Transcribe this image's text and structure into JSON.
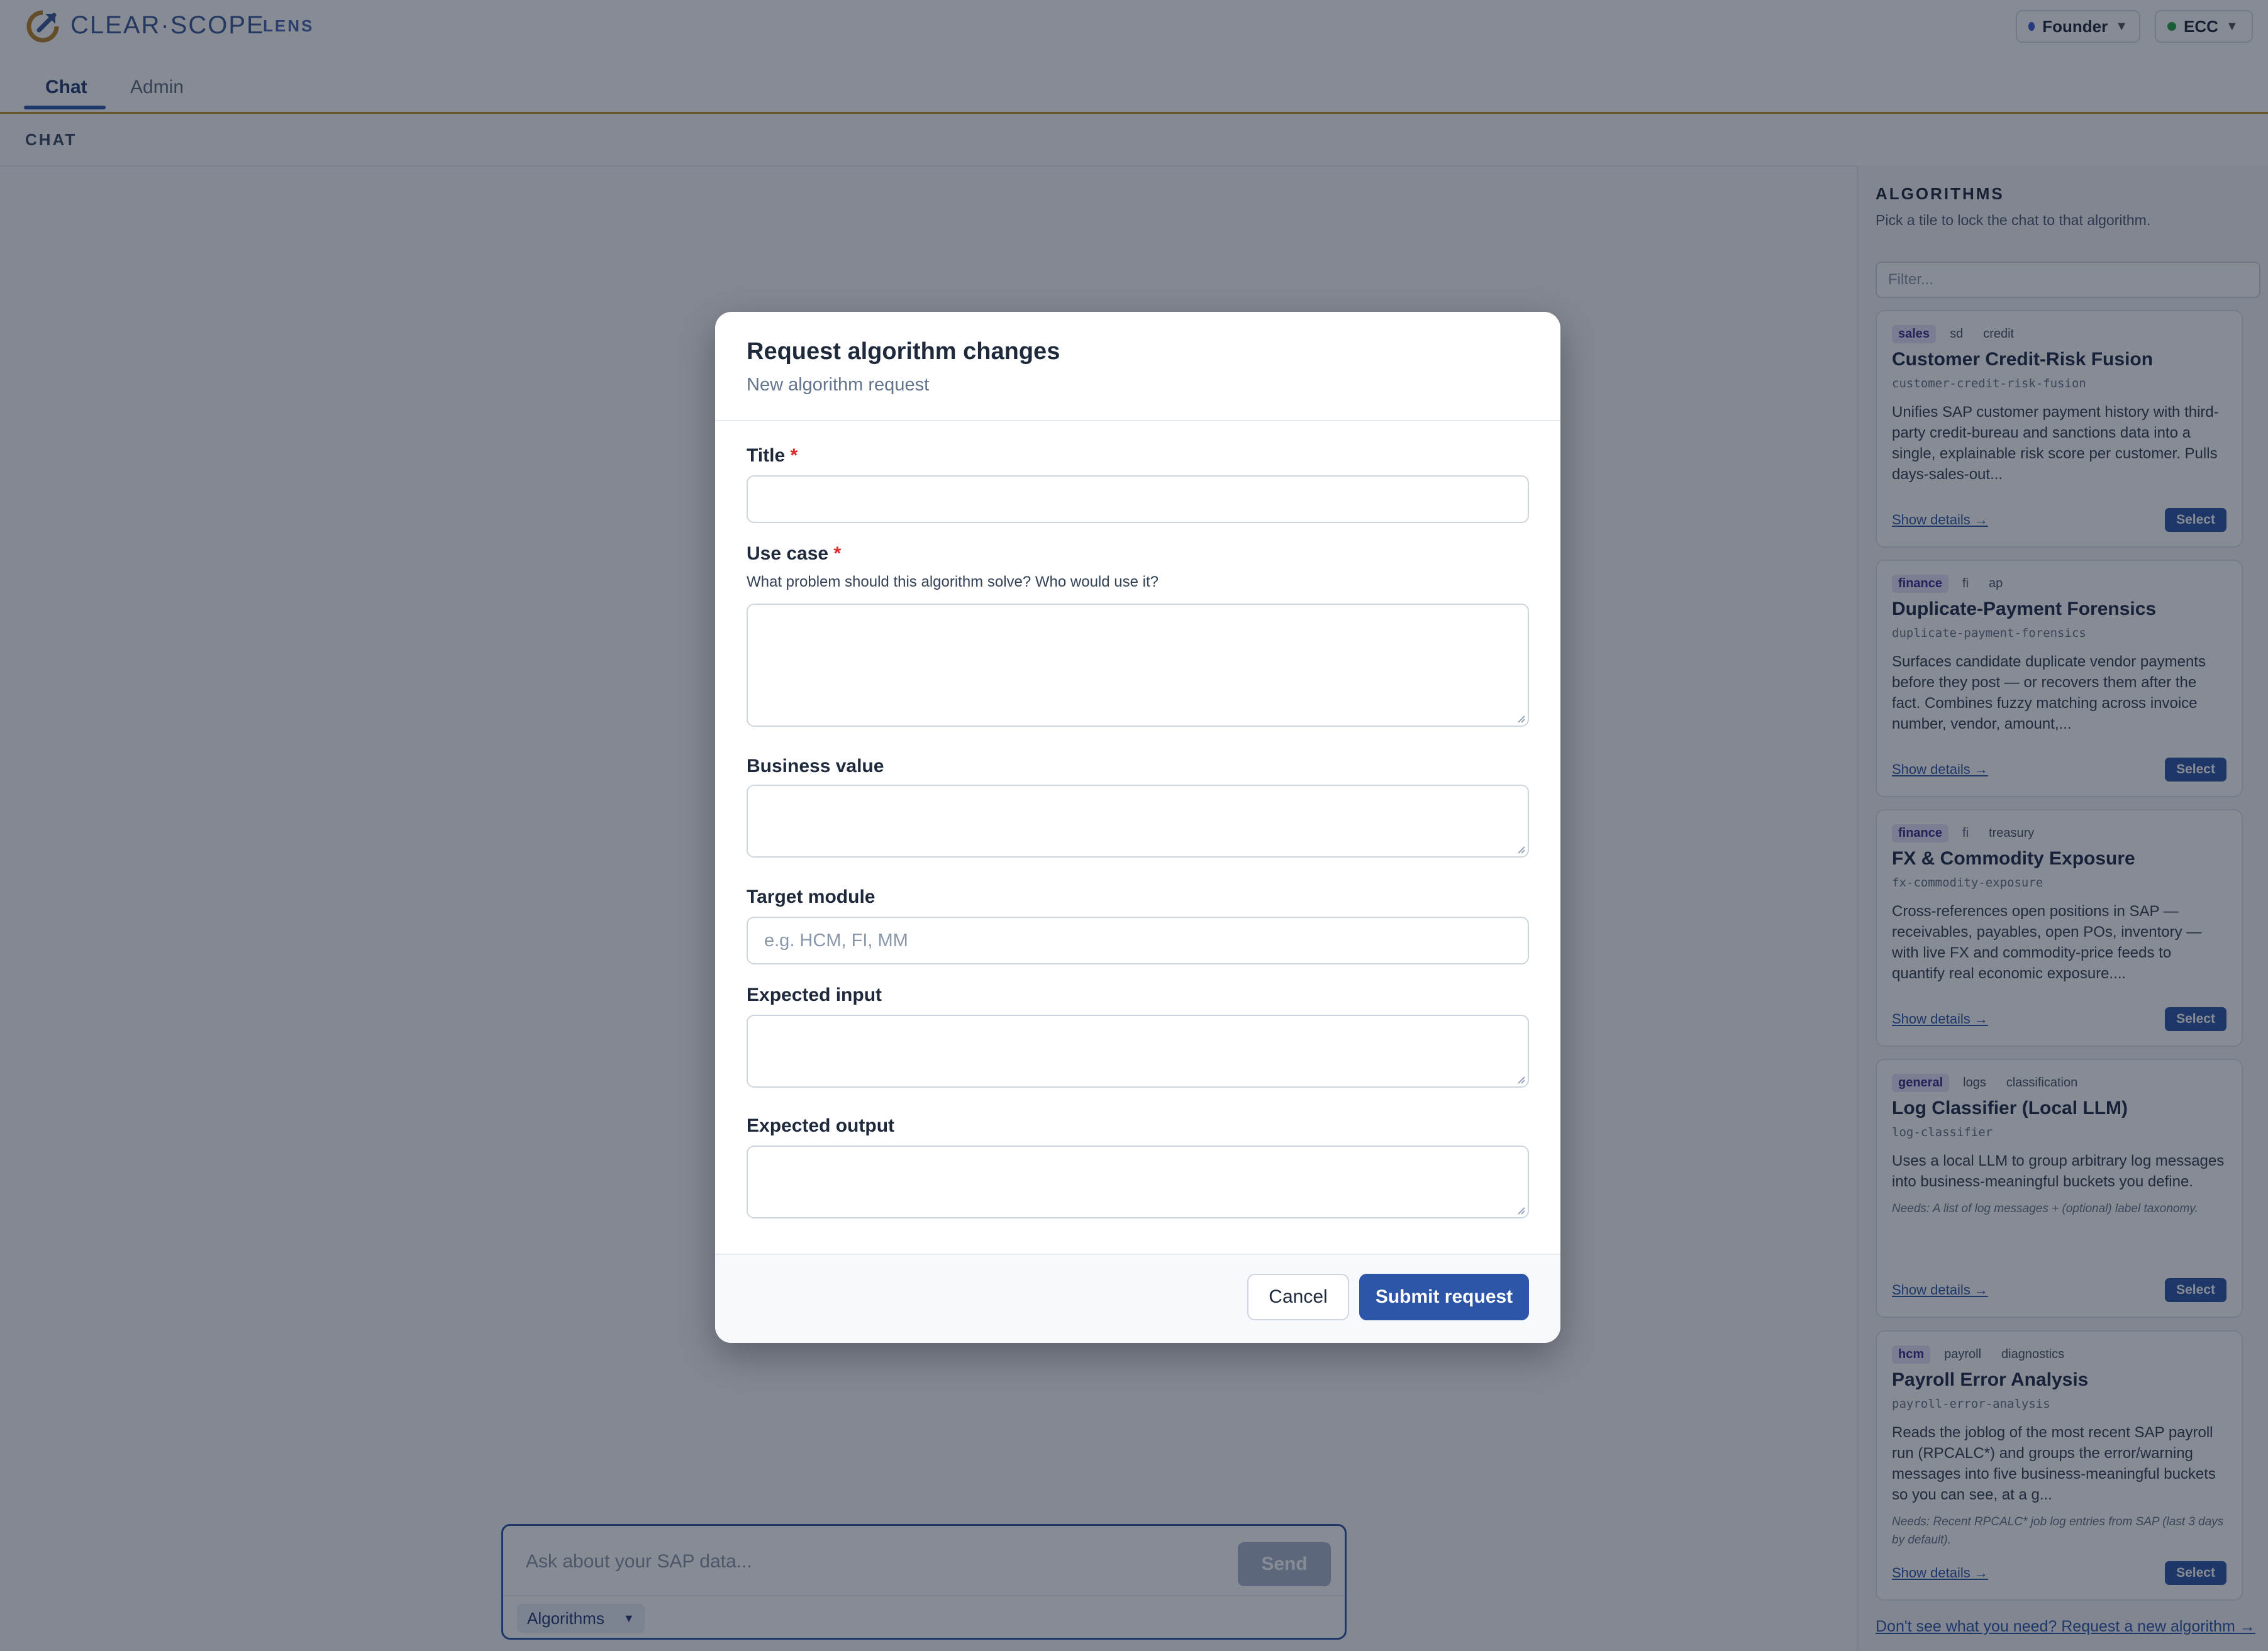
{
  "header": {
    "brand_name": "CLEAR·SCOPE",
    "brand_sub": "LENS",
    "user_role": "Founder",
    "system": "ECC",
    "colors": {
      "role_dot": "#3b5bdb",
      "system_dot": "#22a447"
    }
  },
  "tabs": [
    {
      "label": "Chat",
      "active": true
    },
    {
      "label": "Admin",
      "active": false
    }
  ],
  "section": {
    "label": "CHAT"
  },
  "composer": {
    "placeholder": "Ask about your SAP data...",
    "send_label": "Send",
    "algorithms_label": "Algorithms"
  },
  "sidebar": {
    "title": "ALGORITHMS",
    "subtitle": "Pick a tile to lock the chat to that algorithm.",
    "filter_placeholder": "Filter...",
    "footer_link": "Don't see what you need? Request a new algorithm →",
    "details_label": "Show details →",
    "select_label": "Select",
    "cards": [
      {
        "tags": [
          "sales",
          "sd",
          "credit"
        ],
        "title": "Customer Credit-Risk Fusion",
        "slug": "customer-credit-risk-fusion",
        "description": "Unifies SAP customer payment history with third-party credit-bureau and sanctions data into a single, explainable risk score per customer. Pulls days-sales-out...",
        "needs": ""
      },
      {
        "tags": [
          "finance",
          "fi",
          "ap"
        ],
        "title": "Duplicate-Payment Forensics",
        "slug": "duplicate-payment-forensics",
        "description": "Surfaces candidate duplicate vendor payments before they post — or recovers them after the fact. Combines fuzzy matching across invoice number, vendor, amount,...",
        "needs": ""
      },
      {
        "tags": [
          "finance",
          "fi",
          "treasury"
        ],
        "title": "FX & Commodity Exposure",
        "slug": "fx-commodity-exposure",
        "description": "Cross-references open positions in SAP — receivables, payables, open POs, inventory — with live FX and commodity-price feeds to quantify real economic exposure....",
        "needs": ""
      },
      {
        "tags": [
          "general",
          "logs",
          "classification"
        ],
        "title": "Log Classifier (Local LLM)",
        "slug": "log-classifier",
        "description": "Uses a local LLM to group arbitrary log messages into business-meaningful buckets you define.",
        "needs": "Needs: A list of log messages + (optional) label taxonomy."
      },
      {
        "tags": [
          "hcm",
          "payroll",
          "diagnostics"
        ],
        "title": "Payroll Error Analysis",
        "slug": "payroll-error-analysis",
        "description": "Reads the joblog of the most recent SAP payroll run (RPCALC*) and groups the error/warning messages into five business-meaningful buckets so you can see, at a g...",
        "needs": "Needs: Recent RPCALC* job log entries from SAP (last 3 days by default)."
      }
    ]
  },
  "modal": {
    "title": "Request algorithm changes",
    "subtitle": "New algorithm request",
    "fields": {
      "title": {
        "label": "Title",
        "required": "*",
        "value": ""
      },
      "use_case": {
        "label": "Use case",
        "required": "*",
        "help": "What problem should this algorithm solve? Who would use it?",
        "value": ""
      },
      "business_value": {
        "label": "Business value",
        "value": ""
      },
      "target_module": {
        "label": "Target module",
        "placeholder": "e.g. HCM, FI, MM",
        "value": ""
      },
      "expected_input": {
        "label": "Expected input",
        "value": ""
      },
      "expected_output": {
        "label": "Expected output",
        "value": ""
      }
    },
    "cancel_label": "Cancel",
    "submit_label": "Submit request"
  }
}
